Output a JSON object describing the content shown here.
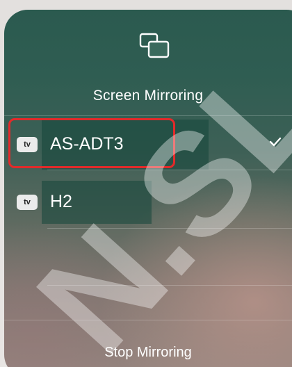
{
  "panel": {
    "title": "Screen Mirroring",
    "icon": "screen-mirroring-icon"
  },
  "devices": [
    {
      "badge": "tv",
      "badge_icon": "apple-tv-badge",
      "name": "AS-ADT3",
      "selected": true
    },
    {
      "badge": "tv",
      "badge_icon": "apple-tv-badge",
      "name": "H2",
      "selected": false
    }
  ],
  "stop_button": {
    "label": "Stop Mirroring"
  },
  "watermark": {
    "text": "N.SL"
  },
  "colors": {
    "highlight": "#e32a2a",
    "text": "#ffffff",
    "panel_top": "#2b5a4f"
  }
}
